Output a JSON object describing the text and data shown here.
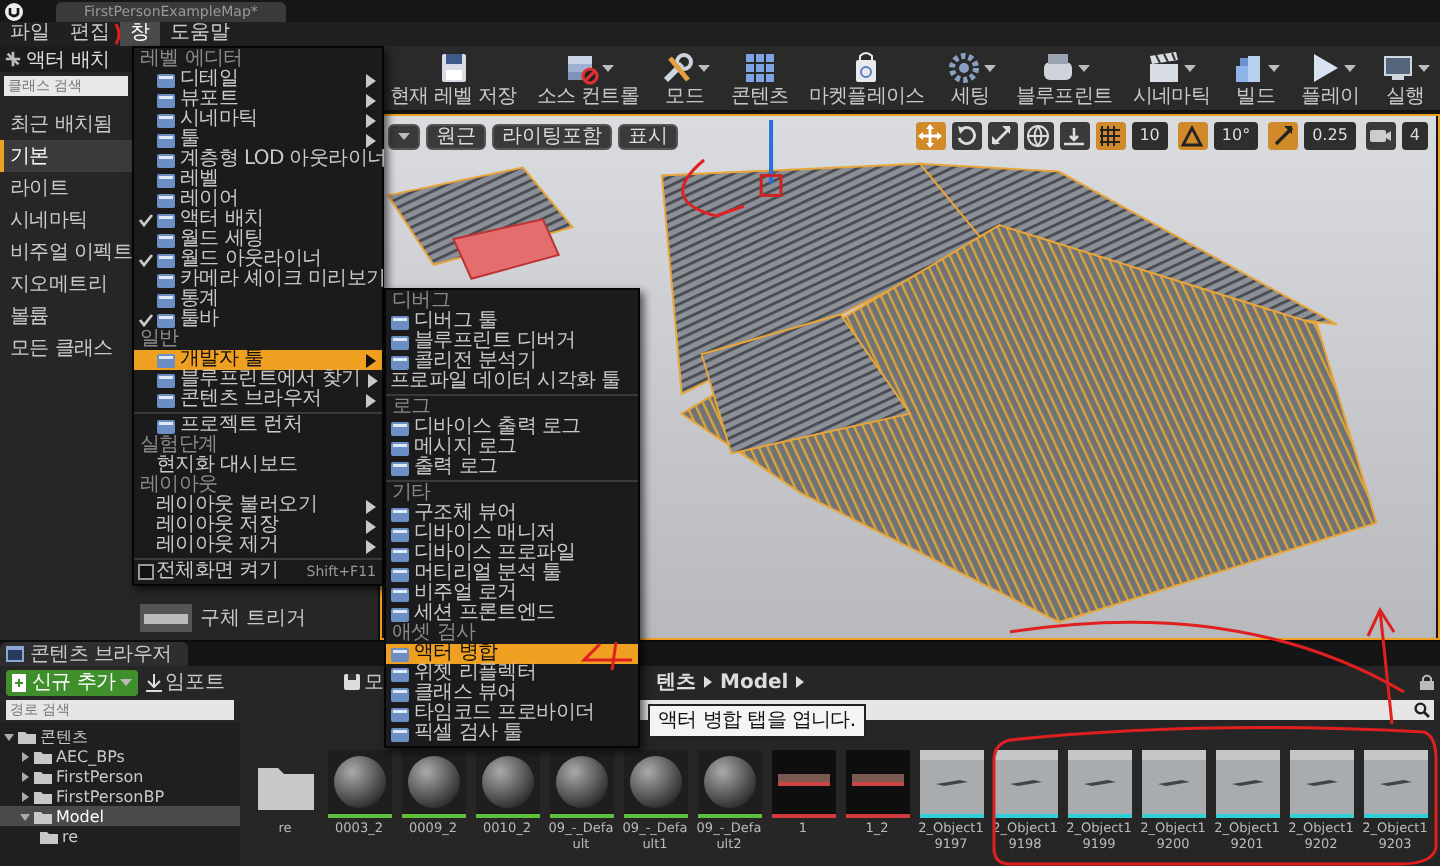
{
  "window": {
    "title": "FirstPersonExampleMap*"
  },
  "menu_bar": [
    {
      "label": "파일",
      "selected": false
    },
    {
      "label": "편집",
      "selected": false
    },
    {
      "label": "창",
      "selected": true
    },
    {
      "label": "도움말",
      "selected": false
    }
  ],
  "place_panel": {
    "title": "액터 배치",
    "search": {
      "placeholder": "클래스 검색"
    },
    "categories": [
      {
        "label": "최근 배치됨",
        "selected": false
      },
      {
        "label": "기본",
        "selected": true
      },
      {
        "label": "라이트",
        "selected": false
      },
      {
        "label": "시네마틱",
        "selected": false
      },
      {
        "label": "비주얼 이펙트",
        "selected": false
      },
      {
        "label": "지오메트리",
        "selected": false
      },
      {
        "label": "볼륨",
        "selected": false
      },
      {
        "label": "모든 클래스",
        "selected": false
      }
    ],
    "items": [
      {
        "label": "구체 트리거"
      }
    ]
  },
  "toolbar": [
    {
      "kind": "save",
      "label": "현재 레벨 저장",
      "dropdown": false
    },
    {
      "kind": "source",
      "label": "소스 컨트롤",
      "dropdown": true
    },
    {
      "kind": "modes",
      "label": "모드",
      "dropdown": true
    },
    {
      "kind": "content",
      "label": "콘텐츠",
      "dropdown": false
    },
    {
      "kind": "market",
      "label": "마켓플레이스",
      "dropdown": false
    },
    {
      "kind": "settings",
      "label": "세팅",
      "dropdown": true
    },
    {
      "kind": "blueprint",
      "label": "블루프린트",
      "dropdown": true
    },
    {
      "kind": "cinematic",
      "label": "시네마틱",
      "dropdown": true
    },
    {
      "kind": "build",
      "label": "빌드",
      "dropdown": true
    },
    {
      "kind": "play",
      "label": "플레이",
      "dropdown": true
    },
    {
      "kind": "launch",
      "label": "실행",
      "dropdown": true
    }
  ],
  "viewport": {
    "view_buttons": [
      {
        "label": "원근"
      },
      {
        "label": "라이팅포함"
      },
      {
        "label": "표시"
      }
    ],
    "transform_tools": [
      {
        "kind": "move",
        "selected": true
      },
      {
        "kind": "rotate",
        "selected": false
      },
      {
        "kind": "scale",
        "selected": false
      }
    ],
    "snaps": [
      {
        "kind": "grid",
        "value": "10",
        "on": true
      },
      {
        "kind": "rotation",
        "value": "10°",
        "on": true
      },
      {
        "kind": "scale",
        "value": "0.25",
        "on": true
      },
      {
        "kind": "camera",
        "value": "4"
      }
    ]
  },
  "window_menu": [
    {
      "kind": "header",
      "label": "레벨 에디터"
    },
    {
      "kind": "item",
      "label": "디테일",
      "icon": true,
      "checked": false,
      "submenu": true,
      "selected": false
    },
    {
      "kind": "item",
      "label": "뷰포트",
      "icon": true,
      "checked": false,
      "submenu": true,
      "selected": false
    },
    {
      "kind": "item",
      "label": "시네마틱",
      "icon": true,
      "checked": false,
      "submenu": true,
      "selected": false
    },
    {
      "kind": "item",
      "label": "툴",
      "icon": true,
      "checked": false,
      "submenu": true,
      "selected": false
    },
    {
      "kind": "item",
      "label": "계층형 LOD 아웃라이너",
      "icon": true,
      "checked": false,
      "submenu": false,
      "selected": false
    },
    {
      "kind": "item",
      "label": "레벨",
      "icon": true,
      "checked": false,
      "submenu": false,
      "selected": false
    },
    {
      "kind": "item",
      "label": "레이어",
      "icon": true,
      "checked": false,
      "submenu": false,
      "selected": false
    },
    {
      "kind": "item",
      "label": "액터 배치",
      "icon": true,
      "checked": true,
      "submenu": false,
      "selected": false
    },
    {
      "kind": "item",
      "label": "월드 세팅",
      "icon": true,
      "checked": false,
      "submenu": false,
      "selected": false
    },
    {
      "kind": "item",
      "label": "월드 아웃라이너",
      "icon": true,
      "checked": true,
      "submenu": false,
      "selected": false
    },
    {
      "kind": "item",
      "label": "카메라 셰이크 미리보기",
      "icon": true,
      "checked": false,
      "submenu": false,
      "selected": false
    },
    {
      "kind": "item",
      "label": "통계",
      "icon": true,
      "checked": false,
      "submenu": false,
      "selected": false
    },
    {
      "kind": "item",
      "label": "툴바",
      "icon": true,
      "checked": true,
      "submenu": false,
      "selected": false
    },
    {
      "kind": "header",
      "label": "일반"
    },
    {
      "kind": "item",
      "label": "개발자 툴",
      "icon": true,
      "checked": false,
      "submenu": true,
      "selected": true
    },
    {
      "kind": "item",
      "label": "블루프린트에서 찾기",
      "icon": true,
      "checked": false,
      "submenu": true,
      "selected": false
    },
    {
      "kind": "item",
      "label": "콘텐츠 브라우저",
      "icon": true,
      "checked": false,
      "submenu": true,
      "selected": false
    },
    {
      "kind": "separator"
    },
    {
      "kind": "item",
      "label": "프로젝트 런처",
      "icon": true,
      "checked": false,
      "submenu": false,
      "selected": false
    },
    {
      "kind": "header",
      "label": "실험단계"
    },
    {
      "kind": "item",
      "label": "현지화 대시보드",
      "icon": false,
      "checked": false,
      "submenu": false,
      "selected": false
    },
    {
      "kind": "header",
      "label": "레이아웃"
    },
    {
      "kind": "item",
      "label": "레이아웃 불러오기",
      "icon": false,
      "checked": false,
      "submenu": true,
      "selected": false
    },
    {
      "kind": "item",
      "label": "레이아웃 저장",
      "icon": false,
      "checked": false,
      "submenu": true,
      "selected": false
    },
    {
      "kind": "item",
      "label": "레이아웃 제거",
      "icon": false,
      "checked": false,
      "submenu": true,
      "selected": false
    },
    {
      "kind": "separator"
    },
    {
      "kind": "checkbox",
      "label": "전체화면 켜기",
      "checked": false,
      "shortcut": "Shift+F11",
      "selected": false
    }
  ],
  "developer_tools_menu": [
    {
      "kind": "header",
      "label": "디버그"
    },
    {
      "kind": "item",
      "label": "디버그 툴",
      "icon": true,
      "selected": false
    },
    {
      "kind": "item",
      "label": "블루프린트 디버거",
      "icon": true,
      "selected": false
    },
    {
      "kind": "item",
      "label": "콜리전 분석기",
      "icon": true,
      "selected": false
    },
    {
      "kind": "item",
      "label": "프로파일 데이터 시각화 툴",
      "icon": false,
      "selected": false
    },
    {
      "kind": "separator"
    },
    {
      "kind": "header",
      "label": "로그"
    },
    {
      "kind": "item",
      "label": "디바이스 출력 로그",
      "icon": true,
      "selected": false
    },
    {
      "kind": "item",
      "label": "메시지 로그",
      "icon": true,
      "selected": false
    },
    {
      "kind": "item",
      "label": "출력 로그",
      "icon": true,
      "selected": false
    },
    {
      "kind": "separator"
    },
    {
      "kind": "header",
      "label": "기타"
    },
    {
      "kind": "item",
      "label": "구조체 뷰어",
      "icon": true,
      "selected": false
    },
    {
      "kind": "item",
      "label": "디바이스 매니저",
      "icon": true,
      "selected": false
    },
    {
      "kind": "item",
      "label": "디바이스 프로파일",
      "icon": true,
      "selected": false
    },
    {
      "kind": "item",
      "label": "머티리얼 분석 툴",
      "icon": true,
      "selected": false
    },
    {
      "kind": "item",
      "label": "비주얼 로거",
      "icon": true,
      "selected": false
    },
    {
      "kind": "item",
      "label": "세션 프론트엔드",
      "icon": true,
      "selected": false
    },
    {
      "kind": "header",
      "label": "애셋 검사"
    },
    {
      "kind": "item",
      "label": "액터 병합",
      "icon": true,
      "selected": true
    },
    {
      "kind": "item",
      "label": "위젯 리플렉터",
      "icon": true,
      "selected": false
    },
    {
      "kind": "item",
      "label": "클래스 뷰어",
      "icon": true,
      "selected": false
    },
    {
      "kind": "item",
      "label": "타임코드 프로바이더",
      "icon": true,
      "selected": false
    },
    {
      "kind": "item",
      "label": "픽셀 검사 툴",
      "icon": true,
      "selected": false
    }
  ],
  "tooltip": {
    "text": "액터 병합 탭을 엽니다."
  },
  "content_browser": {
    "tab": "콘텐츠 브라우저",
    "add_button": "신규 추가",
    "import_button": "임포트",
    "save_button": "모",
    "path": [
      "텐츠",
      "Model"
    ],
    "path_search": {
      "placeholder": "경로 검색"
    },
    "tree": [
      {
        "label": "콘텐츠",
        "expanded": true,
        "selected": false,
        "children": [
          {
            "label": "AEC_BPs",
            "expanded": false,
            "selected": false
          },
          {
            "label": "FirstPerson",
            "expanded": false,
            "selected": false
          },
          {
            "label": "FirstPersonBP",
            "expanded": false,
            "selected": false
          },
          {
            "label": "Model",
            "expanded": true,
            "selected": true,
            "children": [
              {
                "label": "re",
                "selected": false
              }
            ]
          }
        ]
      }
    ],
    "assets": [
      {
        "kind": "folder",
        "label": "re"
      },
      {
        "kind": "material",
        "label": "0003_2"
      },
      {
        "kind": "material",
        "label": "0009_2"
      },
      {
        "kind": "material",
        "label": "0010_2"
      },
      {
        "kind": "material",
        "label": "09_-_Default"
      },
      {
        "kind": "material",
        "label": "09_-_Default1"
      },
      {
        "kind": "material",
        "label": "09_-_Default2"
      },
      {
        "kind": "mesh",
        "label": "1"
      },
      {
        "kind": "mesh",
        "label": "1_2"
      },
      {
        "kind": "object",
        "label": "2_Object19197"
      },
      {
        "kind": "object",
        "label": "2_Object19198"
      },
      {
        "kind": "object",
        "label": "2_Object19199"
      },
      {
        "kind": "object",
        "label": "2_Object19200"
      },
      {
        "kind": "object",
        "label": "2_Object19201"
      },
      {
        "kind": "object",
        "label": "2_Object19202"
      },
      {
        "kind": "object",
        "label": "2_Object19203"
      }
    ]
  }
}
